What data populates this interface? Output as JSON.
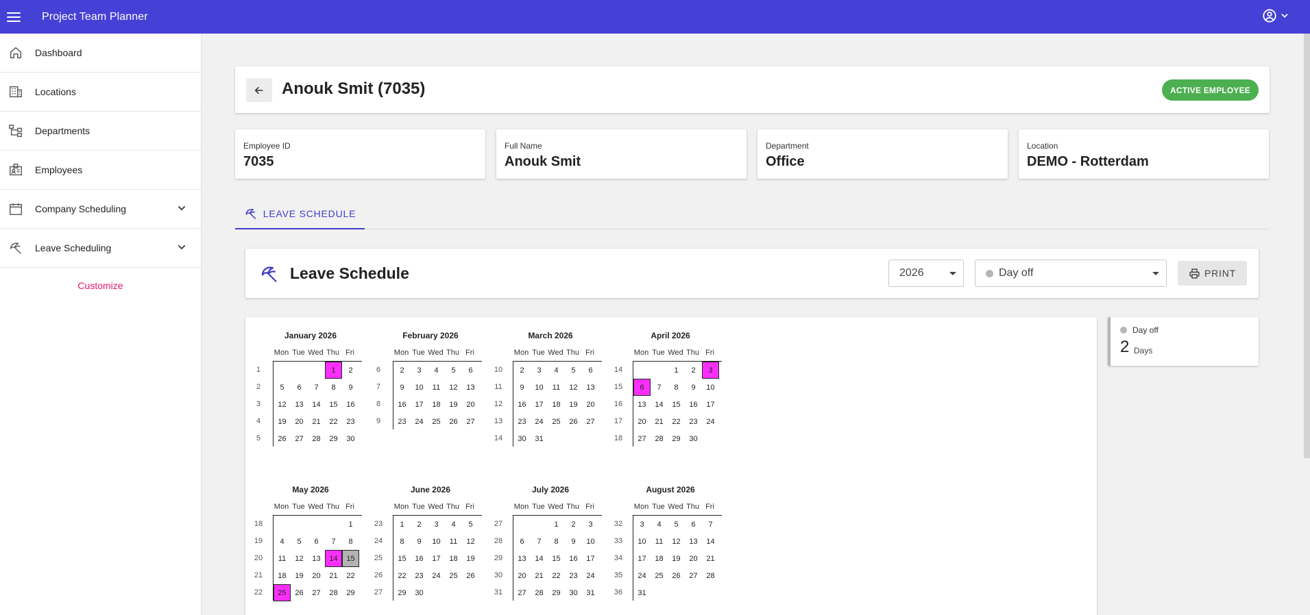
{
  "app": {
    "title": "Project Team Planner"
  },
  "sidebar": {
    "items": [
      {
        "label": "Dashboard",
        "icon": "home-icon",
        "expandable": false
      },
      {
        "label": "Locations",
        "icon": "building-icon",
        "expandable": false
      },
      {
        "label": "Departments",
        "icon": "org-chart-icon",
        "expandable": false
      },
      {
        "label": "Employees",
        "icon": "id-badge-icon",
        "expandable": false
      },
      {
        "label": "Company Scheduling",
        "icon": "calendar-icon",
        "expandable": true
      },
      {
        "label": "Leave Scheduling",
        "icon": "beach-umbrella-icon",
        "expandable": true
      }
    ],
    "customize_label": "Customize"
  },
  "header": {
    "title": "Anouk Smit (7035)",
    "status_badge": "ACTIVE EMPLOYEE"
  },
  "info": [
    {
      "label": "Employee ID",
      "value": "7035"
    },
    {
      "label": "Full Name",
      "value": "Anouk Smit"
    },
    {
      "label": "Department",
      "value": "Office"
    },
    {
      "label": "Location",
      "value": "DEMO - Rotterdam"
    }
  ],
  "tabs": [
    {
      "label": "LEAVE SCHEDULE",
      "active": true
    }
  ],
  "schedule": {
    "title": "Leave Schedule",
    "year_value": "2026",
    "leave_type_value": "Day off",
    "print_label": "PRINT"
  },
  "summary": {
    "label": "Day off",
    "count": "2",
    "unit": "Days"
  },
  "colors": {
    "accent": "#4540d6",
    "leave": "#fb2ffb",
    "holiday": "#b3b3b3",
    "active": "#4caf50",
    "customize": "#e3156f"
  },
  "calendar": {
    "weekdays": [
      "Mon",
      "Tue",
      "Wed",
      "Thu",
      "Fri"
    ],
    "months": [
      {
        "title": "January 2026",
        "weeks": [
          {
            "wk": "1",
            "days": [
              "",
              "",
              "",
              "1",
              "2"
            ],
            "leave": [
              3
            ]
          },
          {
            "wk": "2",
            "days": [
              "5",
              "6",
              "7",
              "8",
              "9"
            ]
          },
          {
            "wk": "3",
            "days": [
              "12",
              "13",
              "14",
              "15",
              "16"
            ]
          },
          {
            "wk": "4",
            "days": [
              "19",
              "20",
              "21",
              "22",
              "23"
            ]
          },
          {
            "wk": "5",
            "days": [
              "26",
              "27",
              "28",
              "29",
              "30"
            ]
          }
        ]
      },
      {
        "title": "February 2026",
        "weeks": [
          {
            "wk": "6",
            "days": [
              "2",
              "3",
              "4",
              "5",
              "6"
            ]
          },
          {
            "wk": "7",
            "days": [
              "9",
              "10",
              "11",
              "12",
              "13"
            ]
          },
          {
            "wk": "8",
            "days": [
              "16",
              "17",
              "18",
              "19",
              "20"
            ]
          },
          {
            "wk": "9",
            "days": [
              "23",
              "24",
              "25",
              "26",
              "27"
            ]
          }
        ]
      },
      {
        "title": "March 2026",
        "weeks": [
          {
            "wk": "10",
            "days": [
              "2",
              "3",
              "4",
              "5",
              "6"
            ]
          },
          {
            "wk": "11",
            "days": [
              "9",
              "10",
              "11",
              "12",
              "13"
            ]
          },
          {
            "wk": "12",
            "days": [
              "16",
              "17",
              "18",
              "19",
              "20"
            ]
          },
          {
            "wk": "13",
            "days": [
              "23",
              "24",
              "25",
              "26",
              "27"
            ]
          },
          {
            "wk": "14",
            "days": [
              "30",
              "31",
              "",
              "",
              ""
            ]
          }
        ]
      },
      {
        "title": "April 2026",
        "weeks": [
          {
            "wk": "14",
            "days": [
              "",
              "",
              "1",
              "2",
              "3"
            ],
            "leave": [
              4
            ]
          },
          {
            "wk": "15",
            "days": [
              "6",
              "7",
              "8",
              "9",
              "10"
            ],
            "leave": [
              0
            ]
          },
          {
            "wk": "16",
            "days": [
              "13",
              "14",
              "15",
              "16",
              "17"
            ]
          },
          {
            "wk": "17",
            "days": [
              "20",
              "21",
              "22",
              "23",
              "24"
            ]
          },
          {
            "wk": "18",
            "days": [
              "27",
              "28",
              "29",
              "30",
              ""
            ]
          }
        ]
      },
      {
        "title": "May 2026",
        "weeks": [
          {
            "wk": "18",
            "days": [
              "",
              "",
              "",
              "",
              "1"
            ]
          },
          {
            "wk": "19",
            "days": [
              "4",
              "5",
              "6",
              "7",
              "8"
            ]
          },
          {
            "wk": "20",
            "days": [
              "11",
              "12",
              "13",
              "14",
              "15"
            ],
            "leave": [
              3
            ],
            "holiday": [
              4
            ]
          },
          {
            "wk": "21",
            "days": [
              "18",
              "19",
              "20",
              "21",
              "22"
            ]
          },
          {
            "wk": "22",
            "days": [
              "25",
              "26",
              "27",
              "28",
              "29"
            ],
            "leave": [
              0
            ]
          }
        ]
      },
      {
        "title": "June 2026",
        "weeks": [
          {
            "wk": "23",
            "days": [
              "1",
              "2",
              "3",
              "4",
              "5"
            ]
          },
          {
            "wk": "24",
            "days": [
              "8",
              "9",
              "10",
              "11",
              "12"
            ]
          },
          {
            "wk": "25",
            "days": [
              "15",
              "16",
              "17",
              "18",
              "19"
            ]
          },
          {
            "wk": "26",
            "days": [
              "22",
              "23",
              "24",
              "25",
              "26"
            ]
          },
          {
            "wk": "27",
            "days": [
              "29",
              "30",
              "",
              "",
              ""
            ]
          }
        ]
      },
      {
        "title": "July 2026",
        "weeks": [
          {
            "wk": "27",
            "days": [
              "",
              "",
              "1",
              "2",
              "3"
            ]
          },
          {
            "wk": "28",
            "days": [
              "6",
              "7",
              "8",
              "9",
              "10"
            ]
          },
          {
            "wk": "29",
            "days": [
              "13",
              "14",
              "15",
              "16",
              "17"
            ]
          },
          {
            "wk": "30",
            "days": [
              "20",
              "21",
              "22",
              "23",
              "24"
            ]
          },
          {
            "wk": "31",
            "days": [
              "27",
              "28",
              "29",
              "30",
              "31"
            ]
          }
        ]
      },
      {
        "title": "August 2026",
        "weeks": [
          {
            "wk": "32",
            "days": [
              "3",
              "4",
              "5",
              "6",
              "7"
            ]
          },
          {
            "wk": "33",
            "days": [
              "10",
              "11",
              "12",
              "13",
              "14"
            ]
          },
          {
            "wk": "34",
            "days": [
              "17",
              "18",
              "19",
              "20",
              "21"
            ]
          },
          {
            "wk": "35",
            "days": [
              "24",
              "25",
              "26",
              "27",
              "28"
            ]
          },
          {
            "wk": "36",
            "days": [
              "31",
              "",
              "",
              "",
              ""
            ]
          }
        ]
      }
    ]
  }
}
